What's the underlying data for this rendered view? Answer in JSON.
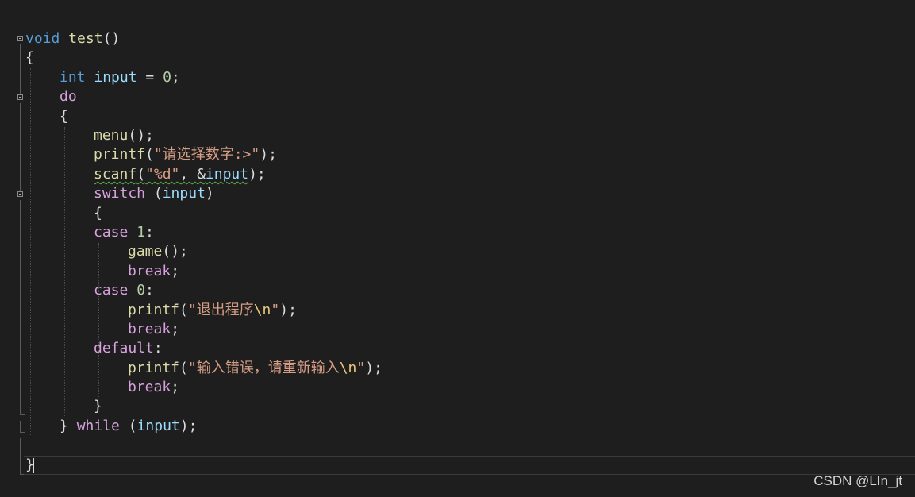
{
  "code": {
    "l1": {
      "kw": "void",
      "fn": "test",
      "rest": "()"
    },
    "l2": "{",
    "l3": {
      "kw": "int",
      "var": "input",
      "op": " = ",
      "num": "0",
      "end": ";"
    },
    "l4": "do",
    "l5": "{",
    "l6": {
      "fn": "menu",
      "rest": "();"
    },
    "l7": {
      "fn": "printf",
      "open": "(",
      "str": "\"请选择数字:>\"",
      "end": ");"
    },
    "l8": {
      "fn": "scanf",
      "open": "(",
      "str": "\"%d\"",
      "mid": ", &",
      "var": "input",
      "end": ");"
    },
    "l9": {
      "kw": "switch",
      "open": " (",
      "var": "input",
      "end": ")"
    },
    "l10": "{",
    "l11": {
      "kw": "case",
      "num": " 1",
      "end": ":"
    },
    "l12": {
      "fn": "game",
      "rest": "();"
    },
    "l13": {
      "kw": "break",
      "end": ";"
    },
    "l14": {
      "kw": "case",
      "num": " 0",
      "end": ":"
    },
    "l15": {
      "fn": "printf",
      "open": "(",
      "str": "\"退出程序",
      "esc": "\\n",
      "strend": "\"",
      "end": ");"
    },
    "l16": {
      "kw": "break",
      "end": ";"
    },
    "l17": {
      "kw": "default",
      "end": ":"
    },
    "l18": {
      "fn": "printf",
      "open": "(",
      "str": "\"输入错误，请重新输入",
      "esc": "\\n",
      "strend": "\"",
      "end": ");"
    },
    "l19": {
      "kw": "break",
      "end": ";"
    },
    "l20": "}",
    "l21": {
      "close": "} ",
      "kw": "while",
      "open": " (",
      "var": "input",
      "end": ");"
    },
    "l23": "}"
  },
  "watermark": "CSDN @LIn_jt",
  "colors": {
    "background": "#1e1e1e",
    "keyword": "#569cd6",
    "control": "#d8a0df",
    "function": "#dcdcaa",
    "variable": "#9cdcfe",
    "number": "#b5cea8",
    "string": "#d69d85"
  }
}
